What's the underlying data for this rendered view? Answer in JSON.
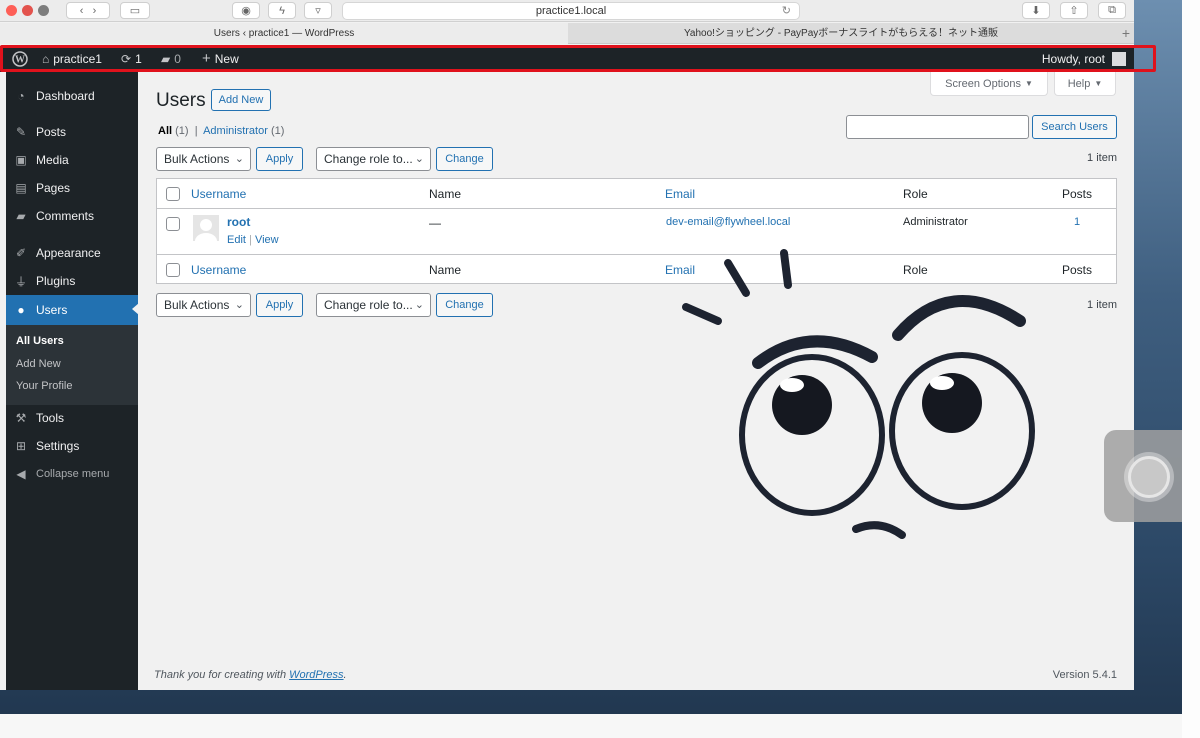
{
  "browser": {
    "url": "practice1.local",
    "tabs": [
      {
        "label": "Users ‹ practice1 — WordPress"
      },
      {
        "label": "Yahoo!ショッピング - PayPayボーナスライトがもらえる！ネット通販"
      }
    ]
  },
  "adminbar": {
    "site_name": "practice1",
    "updates_count": "1",
    "comments_count": "0",
    "new_label": "New",
    "howdy": "Howdy, root"
  },
  "sidebar": {
    "items": [
      {
        "label": "Dashboard",
        "icon": "dashboard-icon"
      },
      {
        "label": "Posts",
        "icon": "pin-icon"
      },
      {
        "label": "Media",
        "icon": "media-icon"
      },
      {
        "label": "Pages",
        "icon": "pages-icon"
      },
      {
        "label": "Comments",
        "icon": "comment-icon"
      },
      {
        "label": "Appearance",
        "icon": "brush-icon"
      },
      {
        "label": "Plugins",
        "icon": "plug-icon"
      },
      {
        "label": "Users",
        "icon": "user-icon"
      },
      {
        "label": "Tools",
        "icon": "wrench-icon"
      },
      {
        "label": "Settings",
        "icon": "settings-icon"
      },
      {
        "label": "Collapse menu",
        "icon": "collapse-icon"
      }
    ],
    "submenu": [
      "All Users",
      "Add New",
      "Your Profile"
    ]
  },
  "screen_options": {
    "screen_options_label": "Screen Options",
    "help_label": "Help"
  },
  "page": {
    "title": "Users",
    "add_new_label": "Add New",
    "filter_all": "All",
    "filter_all_count": "(1)",
    "filter_admin": "Administrator",
    "filter_admin_count": "(1)",
    "search_button": "Search Users",
    "search_value": ""
  },
  "bulk": {
    "bulk_actions": "Bulk Actions",
    "apply": "Apply",
    "change_role": "Change role to...",
    "change": "Change",
    "items_count": "1 item"
  },
  "table": {
    "columns": [
      "Username",
      "Name",
      "Email",
      "Role",
      "Posts"
    ],
    "rows": [
      {
        "username": "root",
        "name": "—",
        "email": "dev-email@flywheel.local",
        "role": "Administrator",
        "posts": "1",
        "action_edit": "Edit",
        "action_view": "View"
      }
    ]
  },
  "footer": {
    "thanks_prefix": "Thank you for creating with",
    "wordpress_link": "WordPress",
    "thanks_suffix": ".",
    "version": "Version 5.4.1"
  }
}
